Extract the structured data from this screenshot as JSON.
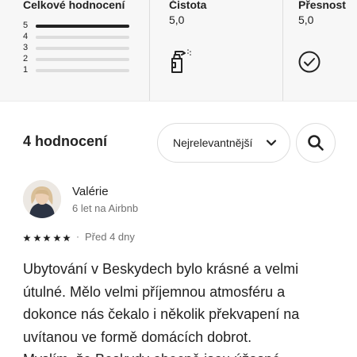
{
  "summary": {
    "overall": {
      "title": "Celkové hodnocení",
      "rows": [
        {
          "label": "5",
          "fraction": 1.0
        },
        {
          "label": "4",
          "fraction": 0.0
        },
        {
          "label": "3",
          "fraction": 0.0
        },
        {
          "label": "2",
          "fraction": 0.0
        },
        {
          "label": "1",
          "fraction": 0.0
        }
      ]
    },
    "cleanliness": {
      "title": "Čistota",
      "value": "5,0",
      "icon": "spray-bottle-icon"
    },
    "accuracy": {
      "title": "Přesnost",
      "value": "5,0",
      "icon": "check-circle-icon"
    }
  },
  "toolbar": {
    "count_label": "4 hodnocení",
    "sort_label": "Nejrelevantnější",
    "sort_icon": "chevron-down-icon",
    "search_icon": "search-icon"
  },
  "review": {
    "name": "Valérie",
    "meta": "6 let na Airbnb",
    "rating": 5,
    "separator": "·",
    "date": "Před 4 dny",
    "lines": [
      "Ubytování v Beskydech bylo krásné a velmi",
      "útulné. Mělo velmi příjemnou atmosféru a",
      "dokonce nás čekalo i několik překvapení na",
      "uvítanou ve formě domácích dobrot.",
      "Myslím, že Beskydy obecně jsou úžasné"
    ]
  },
  "colors": {
    "text": "#222222",
    "muted": "#717171",
    "border": "#dddddd",
    "summary_bg": "#f7f7f7"
  }
}
